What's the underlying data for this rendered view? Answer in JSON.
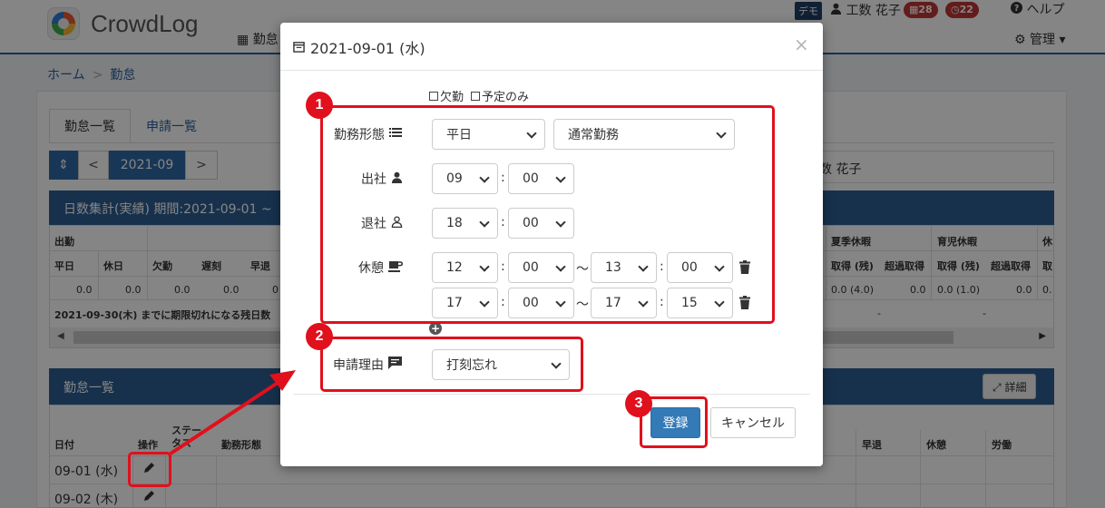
{
  "header": {
    "app_name": "CrowdLog",
    "nav_kintai": "勤怠",
    "demo_badge": "デモ",
    "user_name": "工数 花子",
    "badge_calendar_count": "28",
    "badge_clock_count": "22",
    "help": "ヘルプ",
    "admin": "管理"
  },
  "breadcrumb": {
    "home": "ホーム",
    "current": "勤怠"
  },
  "tabs": {
    "attendance_list": "勤怠一覧",
    "request_list": "申請一覧"
  },
  "month_nav": {
    "prev": "<",
    "month": "2021-09",
    "next": ">"
  },
  "user_box": {
    "name": "数 花子"
  },
  "stats": {
    "title": "日数集計(実績)  期間:2021-09-01 ~",
    "group_shukkin": "出勤",
    "cols_left": [
      "平日",
      "休日",
      "欠勤",
      "遅刻",
      "早退"
    ],
    "vals_left": [
      "0.0",
      "0.0",
      "0.0",
      "0.0",
      "0"
    ],
    "group_summer": "夏季休暇",
    "group_childcare": "育児休暇",
    "group_partial": "休",
    "cols_right": [
      "取得 (残)",
      "超過取得",
      "取得 (残)",
      "超過取得",
      "取"
    ],
    "vals_right": [
      "0.0 (4.0)",
      "0.0",
      "0.0 (1.0)",
      "0.0",
      "0."
    ],
    "expiry_note": "2021-09-30(木) までに期限切れになる残日数",
    "dash": "-"
  },
  "list": {
    "title": "勤怠一覧",
    "detail_button": "詳細",
    "col_date": "日付",
    "col_ops": "操作",
    "col_status_1": "ステー",
    "col_status_2": "タス",
    "col_worktype": "勤務形態",
    "col_early": "早退",
    "col_break": "休憩",
    "col_labor": "労働",
    "rows": [
      "09-01 (水)",
      "09-02 (木)"
    ]
  },
  "modal": {
    "title": "2021-09-01 (水)",
    "close": "×",
    "absence_label": "欠勤",
    "planned_only_label": "予定のみ",
    "worktype_label": "勤務形態",
    "worktype_day": "平日",
    "worktype_kind": "通常勤務",
    "start_label": "出社",
    "start_hour": "09",
    "start_min": "00",
    "end_label": "退社",
    "end_hour": "18",
    "end_min": "00",
    "break_label": "休憩",
    "breaks": [
      {
        "from_h": "12",
        "from_m": "00",
        "to_h": "13",
        "to_m": "00"
      },
      {
        "from_h": "17",
        "from_m": "00",
        "to_h": "17",
        "to_m": "15"
      }
    ],
    "colon": ":",
    "tilde": "〜",
    "reason_label": "申請理由",
    "reason_value": "打刻忘れ",
    "submit": "登録",
    "cancel": "キャンセル"
  },
  "annotations": {
    "n1": "1",
    "n2": "2",
    "n3": "3"
  },
  "colors": {
    "primary": "#337ab7",
    "header_blue": "#2d5f94",
    "annotation_red": "#e0101c",
    "badge_red": "#c03434"
  }
}
